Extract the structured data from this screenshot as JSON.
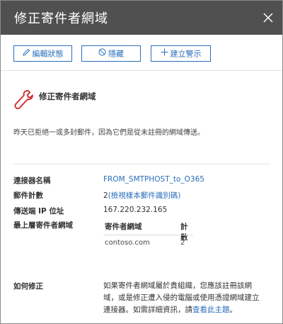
{
  "header": {
    "title": "修正寄件者網域"
  },
  "toolbar": {
    "edit_label": "編輯狀態",
    "hide_label": "隱藏",
    "alert_label": "建立警示"
  },
  "issue": {
    "title": "修正寄件者網域",
    "description": "昨天已拒絕一或多封郵件，因為它們是從未註冊的網域傳送。"
  },
  "details": {
    "connector_label": "連接器名稱",
    "connector_value": "FROM_SMTPHOST_to_O365",
    "message_count_label": "郵件計數",
    "message_count_value": "2",
    "message_count_link": "(檢視樣本郵件識別碼)",
    "sender_ip_label": "傳送端 IP 位址",
    "sender_ip_value": "167.220.232.165",
    "top_domain_label": "最上層寄件者網域",
    "domain_table": {
      "headers": [
        "寄件者網域",
        "計數"
      ],
      "rows": [
        {
          "domain": "contoso.com",
          "count": "2"
        }
      ]
    }
  },
  "fix": {
    "label": "如何修正",
    "text": "如果寄件者網域屬於貴組織，您應該註冊該網域，或是修正遭入侵的電腦或使用憑證網域建立連接器。如需詳細資訊，請",
    "link": "查看此主題",
    "suffix": "。"
  },
  "icons": {
    "close": "close-icon",
    "edit": "pencil-icon",
    "hide": "circle-slash-icon",
    "alert": "plus-icon",
    "issue": "wrench-icon"
  },
  "colors": {
    "header_bg": "#505050",
    "accent": "#2a6ebb",
    "issue_icon": "#d13438"
  }
}
